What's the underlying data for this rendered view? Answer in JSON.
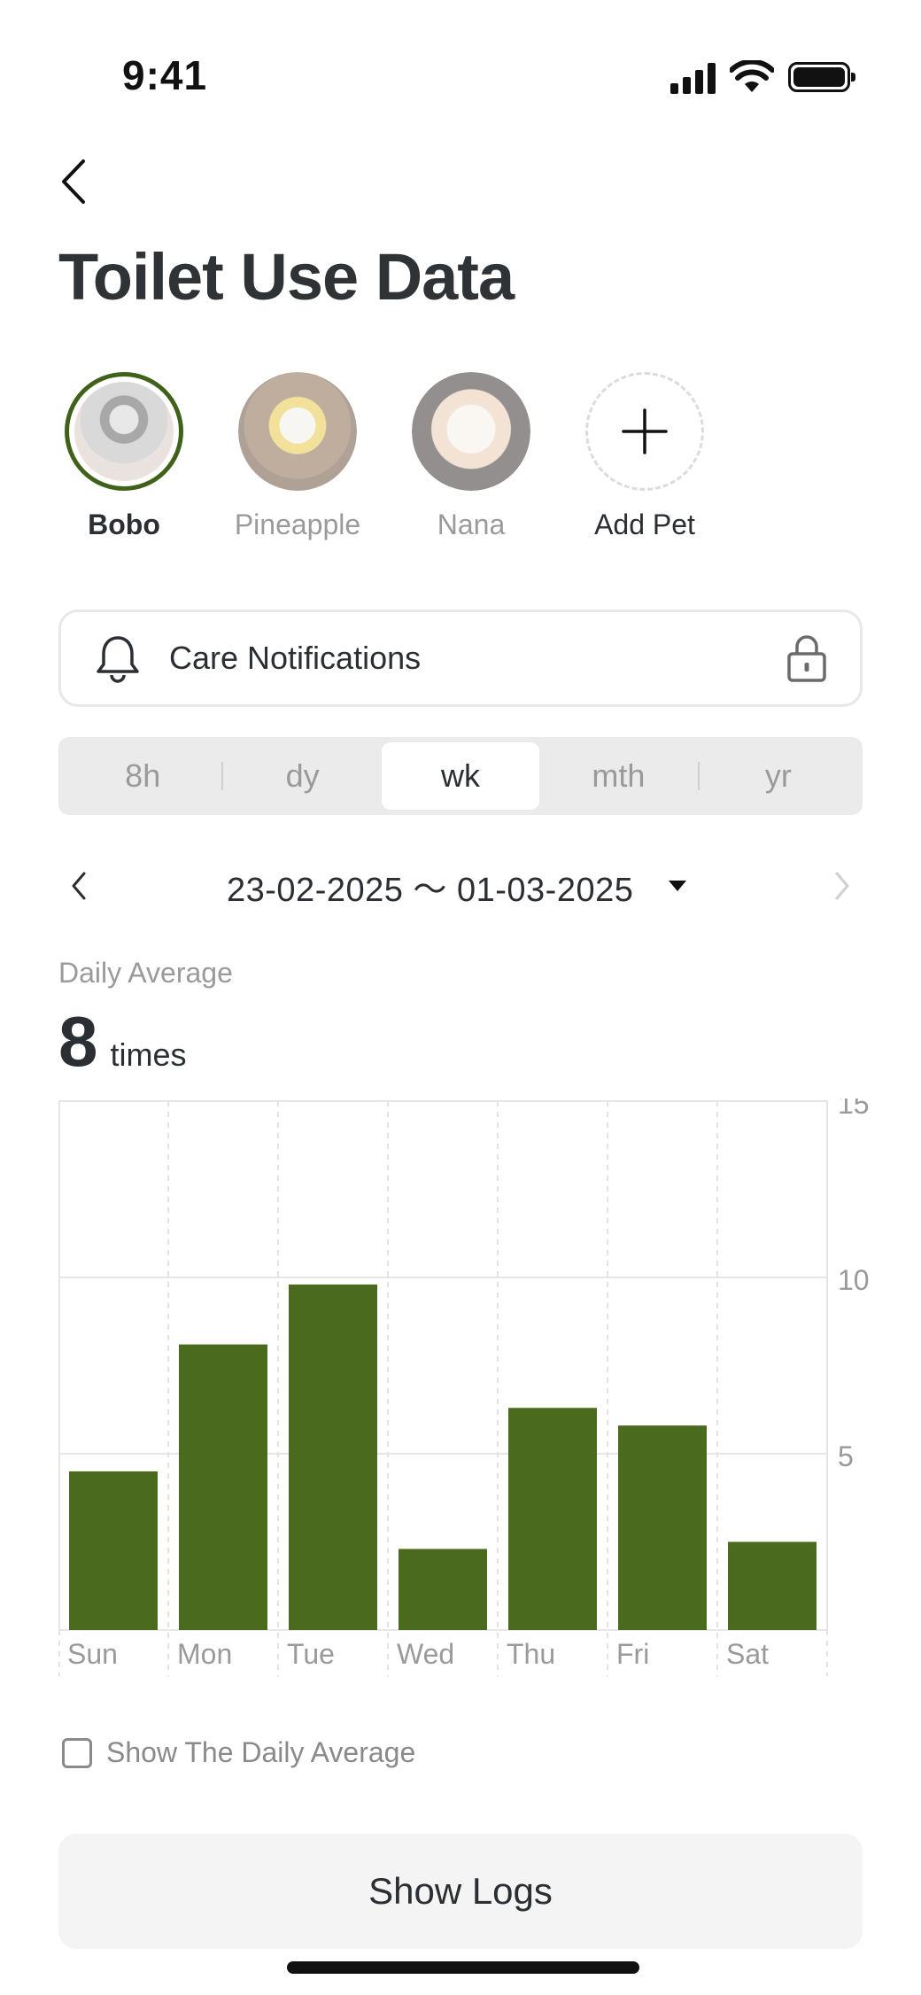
{
  "status_bar": {
    "time": "9:41"
  },
  "header": {
    "title": "Toilet Use Data"
  },
  "pets": [
    {
      "name": "Bobo",
      "selected": true
    },
    {
      "name": "Pineapple",
      "selected": false
    },
    {
      "name": "Nana",
      "selected": false
    }
  ],
  "add_pet_label": "Add Pet",
  "care": {
    "label": "Care Notifications"
  },
  "periods": [
    "8h",
    "dy",
    "wk",
    "mth",
    "yr"
  ],
  "selected_period": "wk",
  "date_range": "23-02-2025 〜 01-03-2025",
  "summary": {
    "label": "Daily Average",
    "value": "8",
    "unit": "times"
  },
  "checkbox_label": "Show The Daily Average",
  "logs_button": "Show Logs",
  "colors": {
    "accent": "#4a6b1d",
    "selected_ring": "#3f6119"
  },
  "chart_data": {
    "type": "bar",
    "categories": [
      "Sun",
      "Mon",
      "Tue",
      "Wed",
      "Thu",
      "Fri",
      "Sat"
    ],
    "values": [
      4.5,
      8.1,
      9.8,
      2.3,
      6.3,
      5.8,
      2.5
    ],
    "ylim": [
      0,
      15
    ],
    "yticks": [
      5,
      10,
      15
    ],
    "grid": true,
    "y_axis_position": "right"
  }
}
